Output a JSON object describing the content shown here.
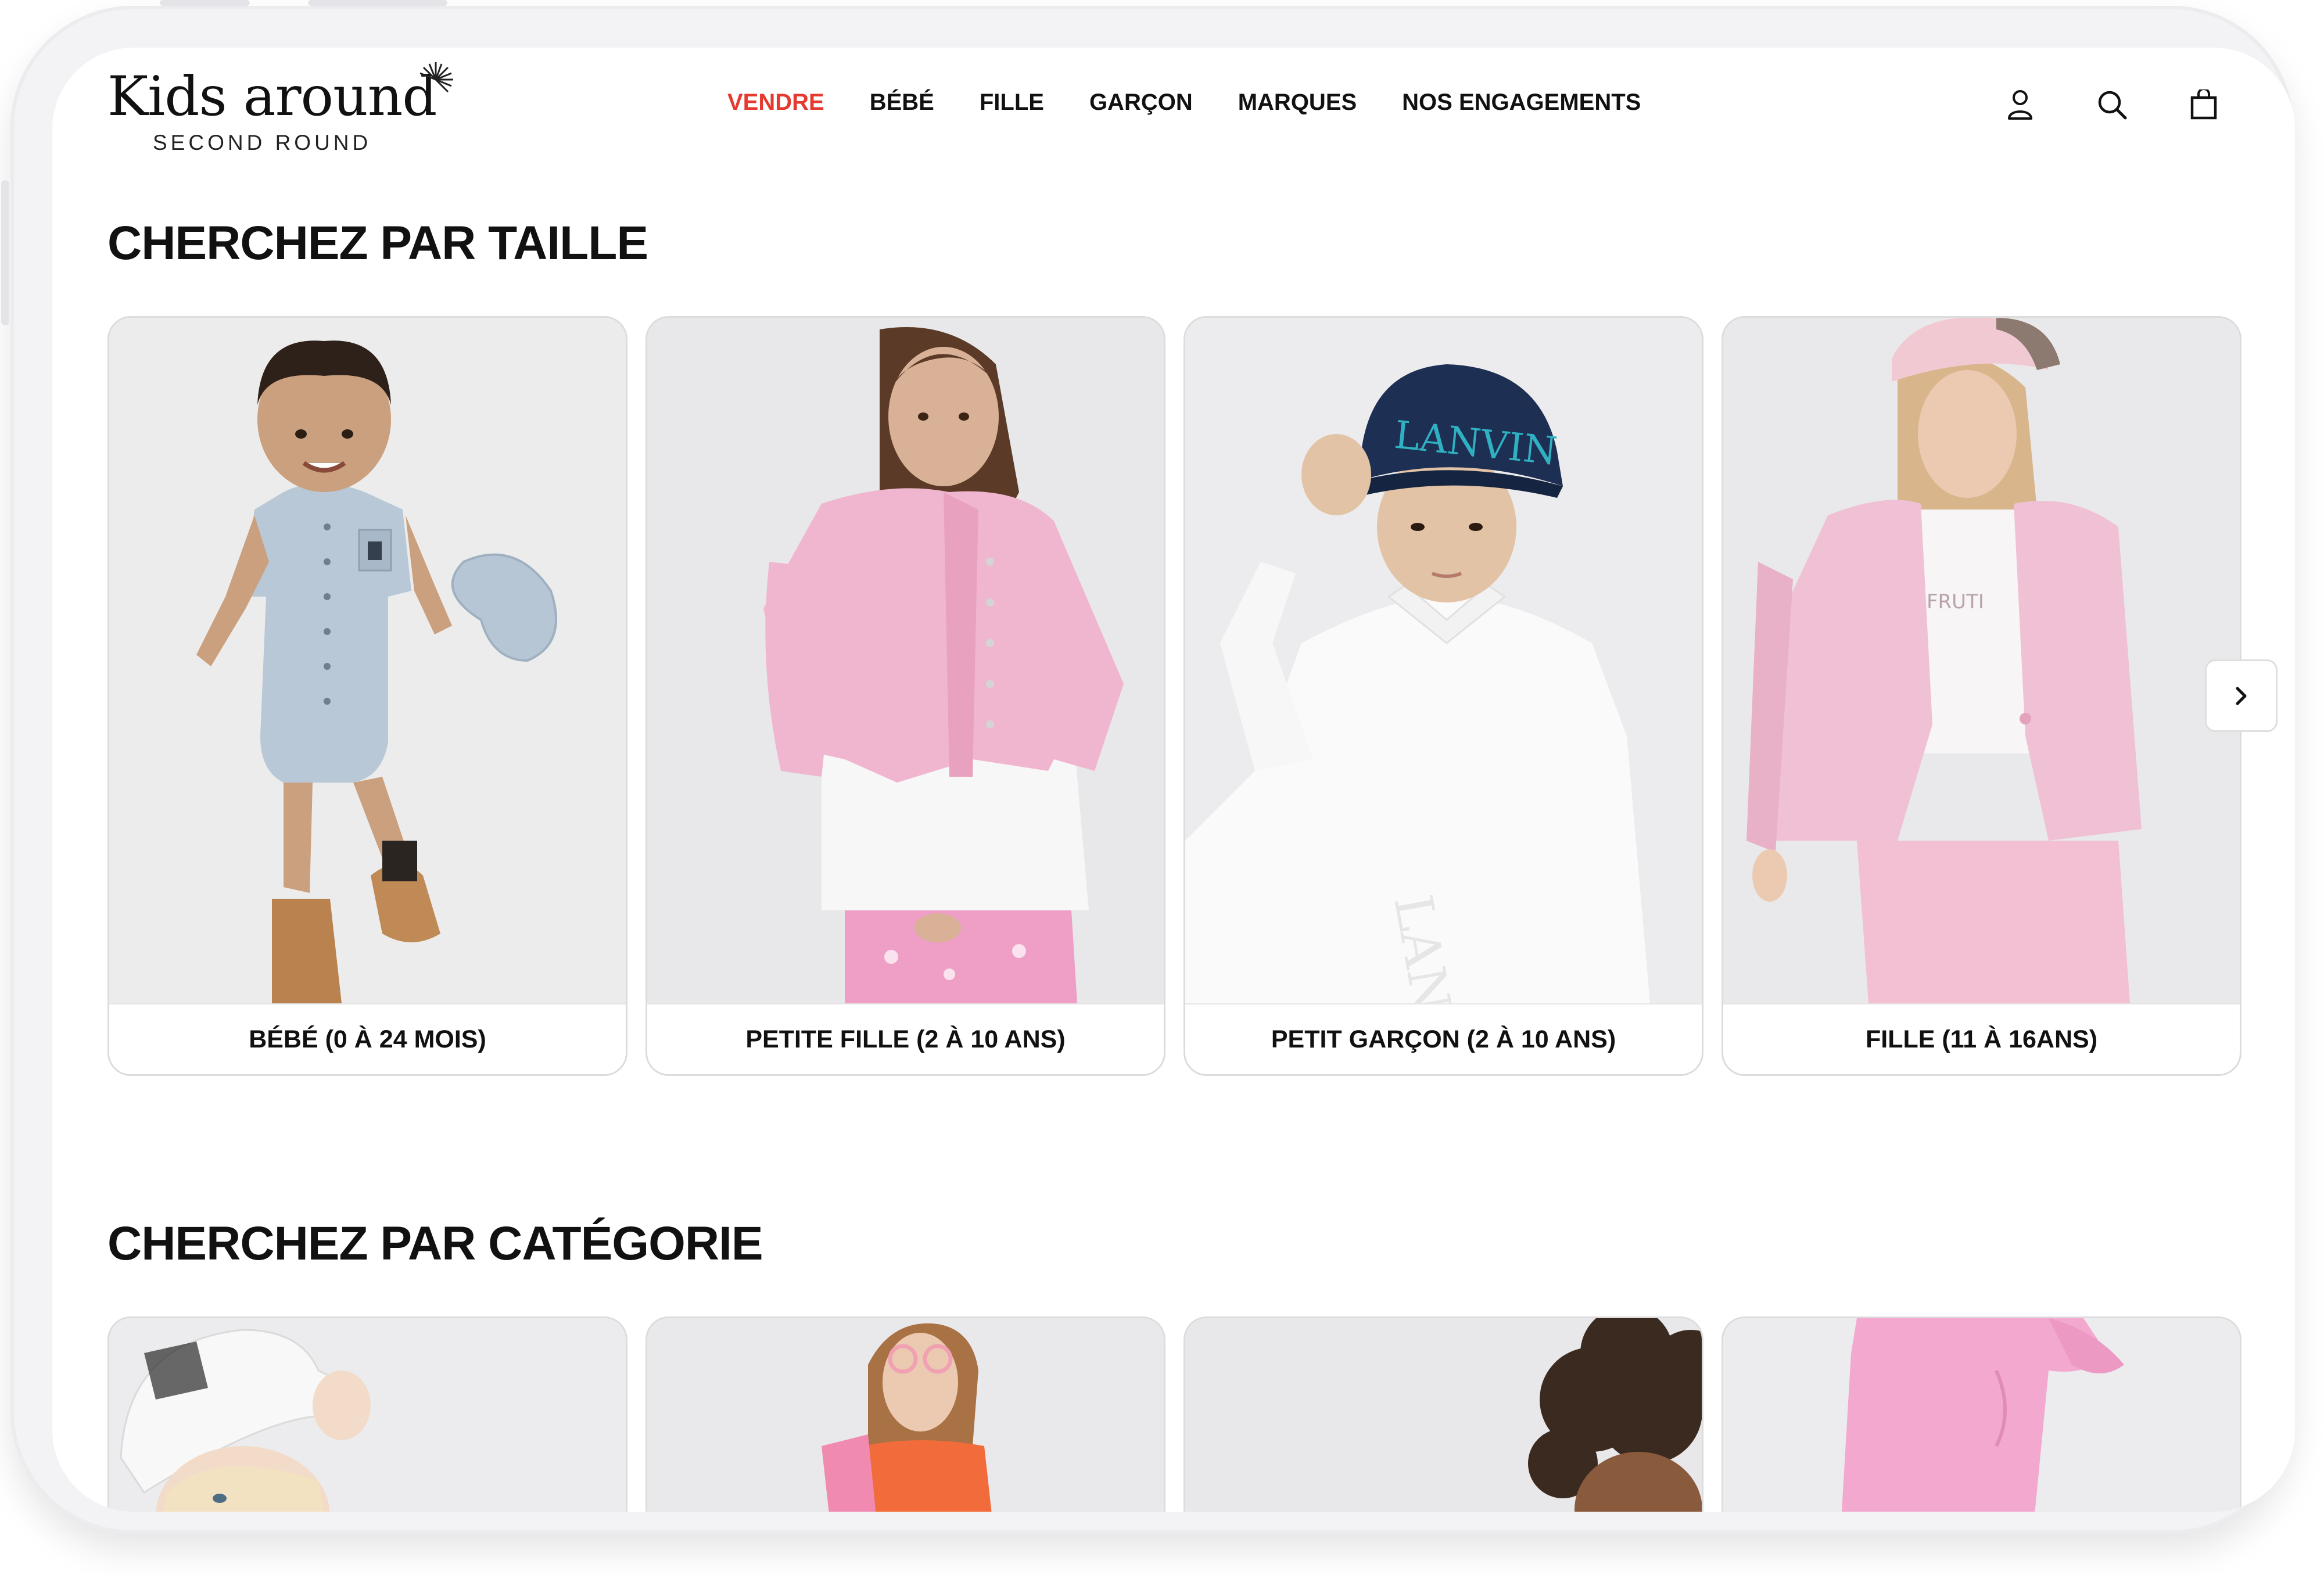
{
  "brand": {
    "name": "Kids around",
    "tagline": "SECOND ROUND",
    "accent_color": "#e53a2f"
  },
  "nav": {
    "items": [
      {
        "label": "VENDRE",
        "active": true
      },
      {
        "label": "BÉBÉ",
        "active": false
      },
      {
        "label": "FILLE",
        "active": false
      },
      {
        "label": "GARÇON",
        "active": false
      },
      {
        "label": "MARQUES",
        "active": false
      },
      {
        "label": "NOS ENGAGEMENTS",
        "active": false
      }
    ]
  },
  "header_icons": [
    "user-icon",
    "search-icon",
    "shopping-bag-icon"
  ],
  "size_section": {
    "title": "CHERCHEZ PAR TAILLE",
    "cards": [
      {
        "label": "BÉBÉ (0 À 24 MOIS)"
      },
      {
        "label": "PETITE FILLE (2 À 10 ANS)"
      },
      {
        "label": "PETIT GARÇON (2 À 10 ANS)"
      },
      {
        "label": "FILLE (11 À 16ANS)"
      }
    ],
    "next_icon": "chevron-right-icon"
  },
  "category_section": {
    "title": "CHERCHEZ PAR CATÉGORIE"
  },
  "photo_texts": {
    "cap_brand": "LANVIN"
  }
}
